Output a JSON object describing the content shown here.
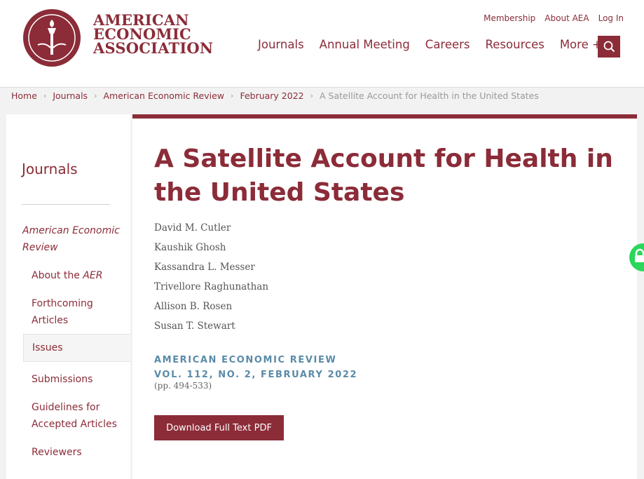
{
  "header": {
    "logo_lines": [
      "AMERICAN",
      "ECONOMIC",
      "ASSOCIATION"
    ],
    "top_links": [
      "Membership",
      "About AEA",
      "Log In"
    ],
    "nav": [
      "Journals",
      "Annual Meeting",
      "Careers",
      "Resources",
      "More +"
    ],
    "colors": {
      "brand": "#8b2c38",
      "accent": "#5a8ba8",
      "lock": "#2bd65a"
    }
  },
  "breadcrumb": {
    "items": [
      "Home",
      "Journals",
      "American Economic Review",
      "February 2022"
    ],
    "current": "A Satellite Account for Health in the United States",
    "separator": "›"
  },
  "sidebar": {
    "title": "Journals",
    "journal": "American Economic Review",
    "items": [
      {
        "label": "About the ",
        "em": "AER"
      },
      {
        "label": "Forthcoming Articles"
      },
      {
        "label": "Issues",
        "active": true
      },
      {
        "label": "Submissions"
      },
      {
        "label": "Guidelines for Accepted Articles"
      },
      {
        "label": "Reviewers"
      }
    ]
  },
  "article": {
    "title": "A Satellite Account for Health in the United States",
    "authors": [
      "David M. Cutler",
      "Kaushik Ghosh",
      "Kassandra L. Messer",
      "Trivellore Raghunathan",
      "Allison B. Rosen",
      "Susan T. Stewart"
    ],
    "journal_name": "AMERICAN ECONOMIC REVIEW",
    "volume": "VOL. 112, NO. 2, FEBRUARY 2022",
    "pages": "(pp. 494-533)",
    "pdf_label": "Download Full Text PDF"
  }
}
